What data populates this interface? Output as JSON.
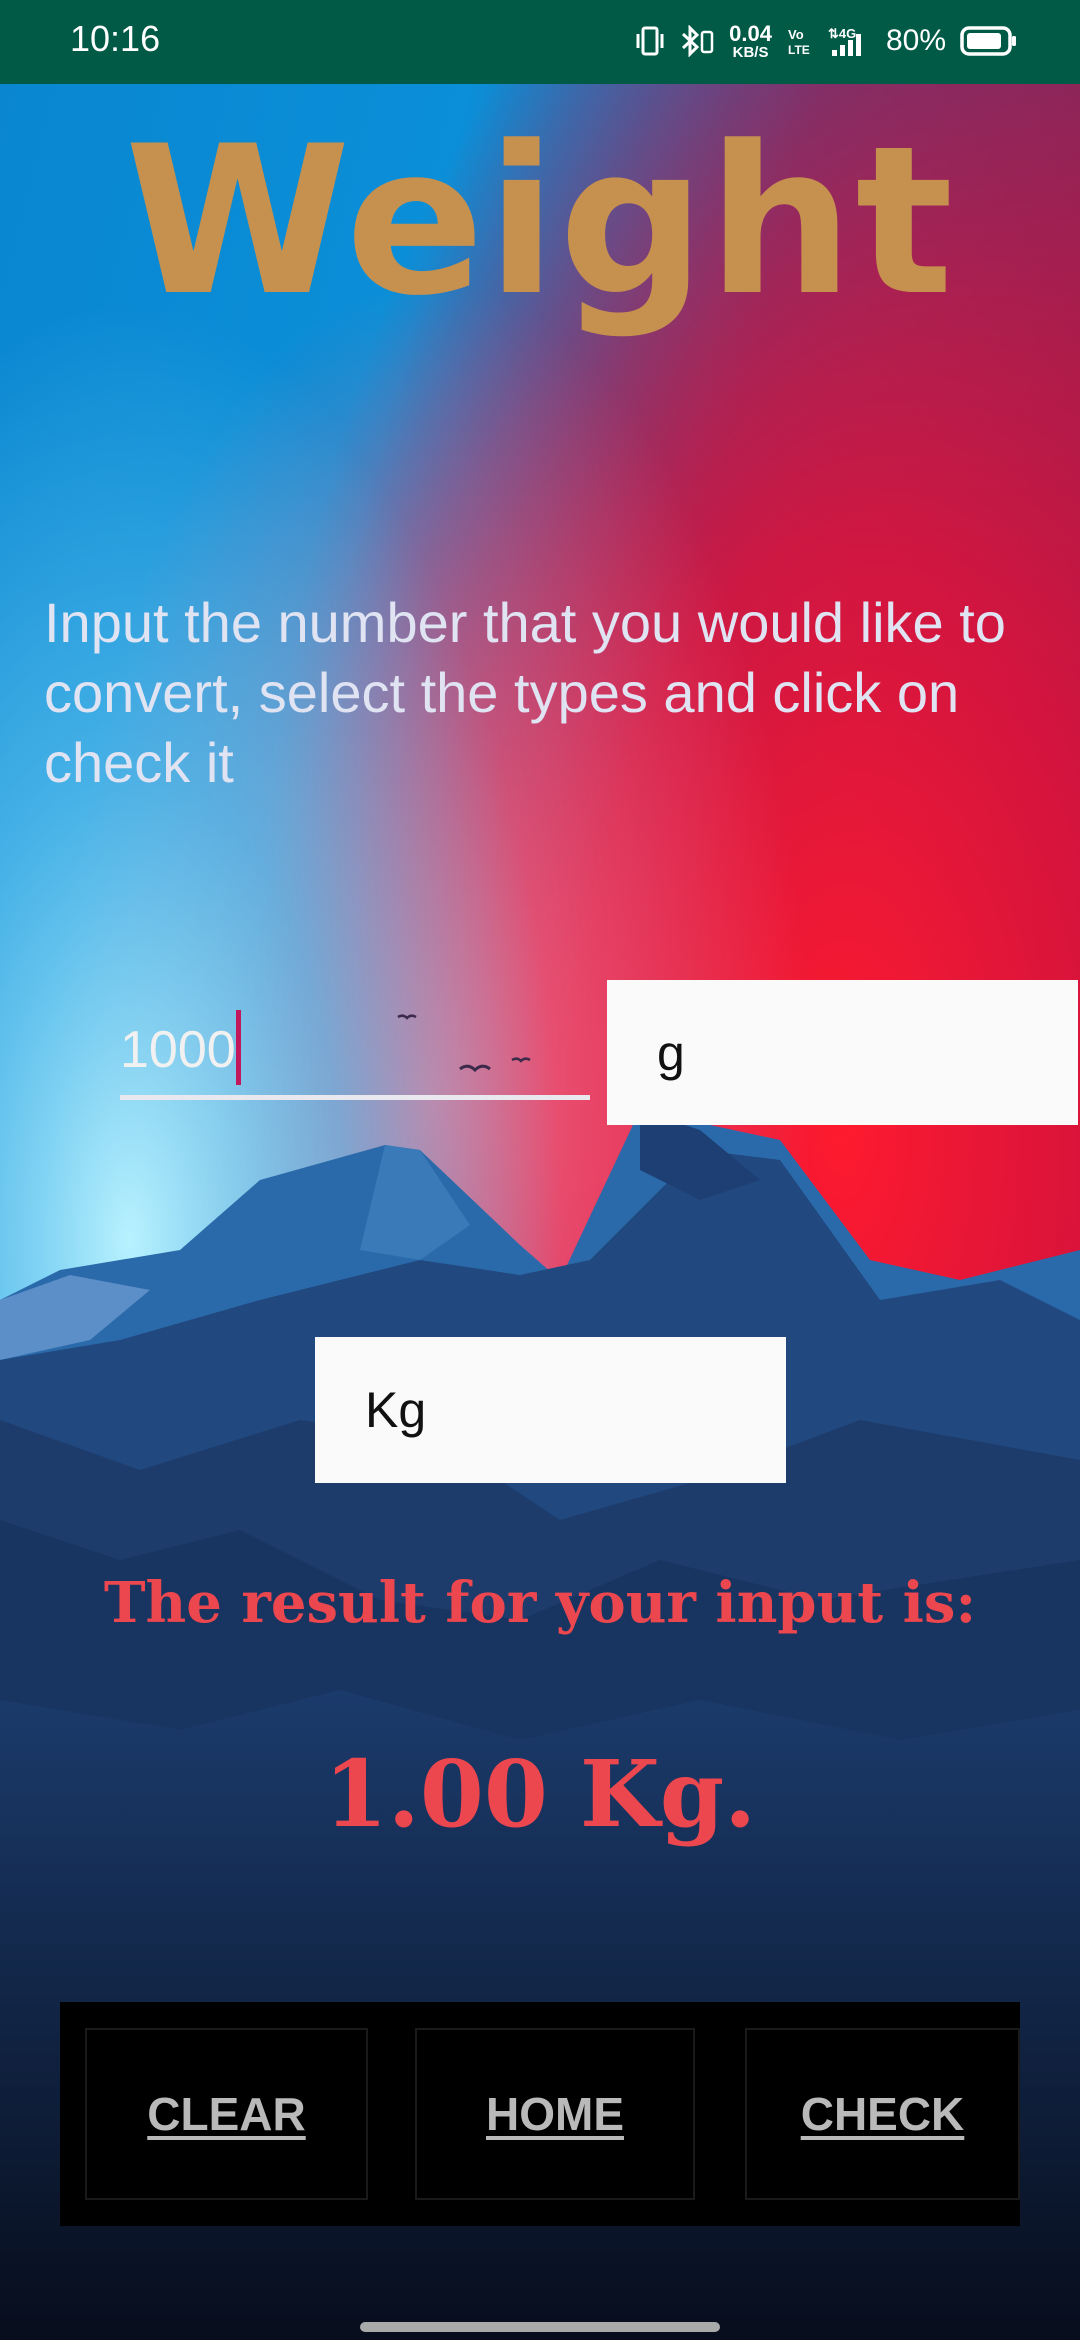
{
  "status_bar": {
    "time": "10:16",
    "net_speed_value": "0.04",
    "net_speed_unit": "KB/S",
    "battery_percent": "80%",
    "icons": [
      "vibrate-icon",
      "bluetooth-icon",
      "volte-icon",
      "signal-4g-icon",
      "battery-icon"
    ]
  },
  "screen": {
    "title": "Weight",
    "instructions": "Input the number that you would like to convert, select the types and click on check it"
  },
  "converter": {
    "input_value": "1000",
    "from_unit": "g",
    "to_unit": "Kg"
  },
  "result": {
    "label": "The result for your input is:",
    "value": "1.00 Kg."
  },
  "buttons": {
    "clear": "CLEAR",
    "home": "HOME",
    "check": "CHECK"
  },
  "colors": {
    "title": "#c6904f",
    "result": "#ec474e",
    "status_bar": "#005a46",
    "caret": "#c2185b"
  }
}
